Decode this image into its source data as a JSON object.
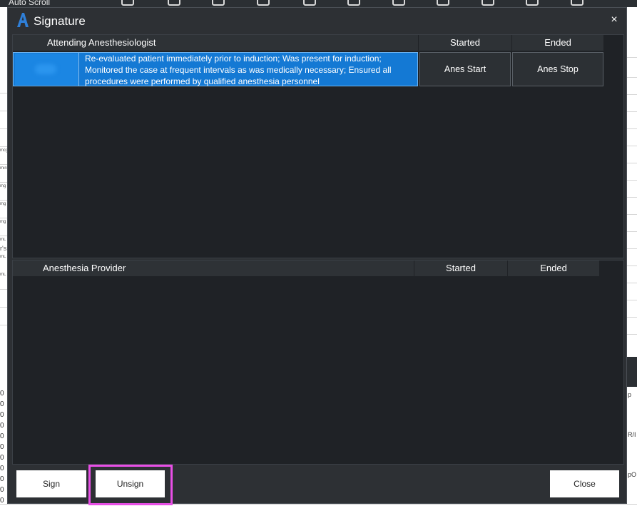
{
  "background_app": {
    "autoscroll_label": "Auto Scroll",
    "left_unit_labels": [
      "mcg",
      "min",
      "mg",
      "mg",
      "mg",
      "mL",
      "r's",
      "mL",
      "mL"
    ],
    "left_numbers": [
      "0",
      "0",
      "0",
      "0",
      "0",
      "0",
      "0",
      "0",
      "0",
      "0",
      "0",
      "0"
    ],
    "right_labels": [
      "p",
      "R/I",
      "pO"
    ]
  },
  "dialog": {
    "title": "Signature",
    "close_label": "×",
    "logo_color": "#2f7fd8",
    "top_panel": {
      "headers": {
        "name": "Attending Anesthesiologist",
        "started": "Started",
        "ended": "Ended"
      },
      "rows": [
        {
          "statement": "Re-evaluated patient immediately prior to induction; Was present for induction;\nMonitored the case at frequent intervals as was medically necessary; Ensured all\nprocedures were performed by qualified anesthesia personnel",
          "start_button": "Anes Start",
          "stop_button": "Anes Stop"
        }
      ]
    },
    "bottom_panel": {
      "headers": {
        "name": "Anesthesia Provider",
        "started": "Started",
        "ended": "Ended"
      }
    },
    "footer": {
      "sign": "Sign",
      "unsign": "Unsign",
      "close": "Close"
    }
  },
  "colors": {
    "dialog_bg": "#2d3034",
    "panel_bg": "#1f2226",
    "selected_row": "#1479d4",
    "highlight_border": "#e84fe6"
  }
}
